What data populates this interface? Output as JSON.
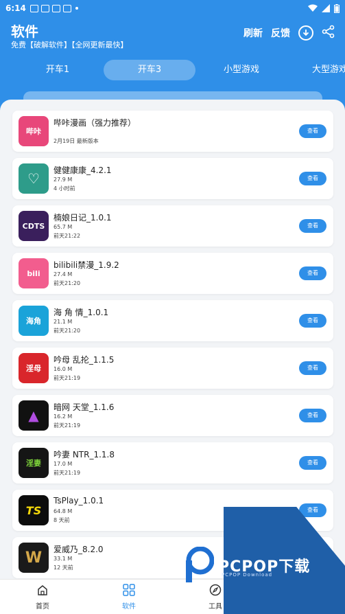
{
  "status": {
    "time": "6:14"
  },
  "header": {
    "title": "软件",
    "subtitle": "免费【破解软件】【全网更新最快】",
    "refresh_label": "刷新",
    "feedback_label": "反馈",
    "download_icon": "download-icon",
    "share_icon": "share-icon"
  },
  "tabs": [
    {
      "label": "开车1"
    },
    {
      "label": "开车3",
      "active": true
    },
    {
      "label": "小型游戏"
    },
    {
      "label": "大型游戏"
    }
  ],
  "apps": [
    {
      "name": "哔咔漫画（强力推荐）",
      "size": "",
      "time": "2月19日 最新版本",
      "button": "查看",
      "color": "#e8477a",
      "glyph": "哔咔"
    },
    {
      "name": "健健康康_4.2.1",
      "size": "27.9 M",
      "time": "4 小时前",
      "button": "查看",
      "color": "#2e9c8a",
      "glyph": "♡"
    },
    {
      "name": "楠娘日记_1.0.1",
      "size": "65.7 M",
      "time": "前天21:22",
      "button": "查看",
      "color": "#3a1f5c",
      "glyph": "CDTS"
    },
    {
      "name": "bilibili禁漫_1.9.2",
      "size": "27.4 M",
      "time": "前天21:20",
      "button": "查看",
      "color": "#f25d8e",
      "glyph": "bili"
    },
    {
      "name": "海 角 情_1.0.1",
      "size": "21.1 M",
      "time": "前天21:20",
      "button": "查看",
      "color": "#1aa3d9",
      "glyph": "海角"
    },
    {
      "name": "吟母 乱抡_1.1.5",
      "size": "16.0 M",
      "time": "前天21:19",
      "button": "查看",
      "color": "#d9262b",
      "glyph": "淫母"
    },
    {
      "name": "暗网 天堂_1.1.6",
      "size": "16.2 M",
      "time": "前天21:19",
      "button": "查看",
      "color": "#111111",
      "glyph": "▲"
    },
    {
      "name": "吟妻 NTR_1.1.8",
      "size": "17.0 M",
      "time": "前天21:19",
      "button": "查看",
      "color": "#151515",
      "glyph": "淫妻"
    },
    {
      "name": "TsPlay_1.0.1",
      "size": "64.8 M",
      "time": "8 天前",
      "button": "查看",
      "color": "#0d0d0d",
      "glyph": "TS"
    },
    {
      "name": "爱威乃_8.2.0",
      "size": "33.1 M",
      "time": "12 天前",
      "button": "查看",
      "color": "#1a1a1a",
      "glyph": "W"
    }
  ],
  "bottom_nav": [
    {
      "label": "首页",
      "icon": "home-icon"
    },
    {
      "label": "软件",
      "icon": "grid-icon",
      "active": true
    },
    {
      "label": "工具",
      "icon": "compass-icon"
    },
    {
      "label": "我的",
      "icon": "user-icon"
    }
  ],
  "watermark": {
    "brand": "PCPOP下载",
    "sub": "PCPOP Download"
  },
  "colors": {
    "primary": "#2f8fe8",
    "background": "#f2f4f7",
    "watermark": "#1f5fa8"
  }
}
